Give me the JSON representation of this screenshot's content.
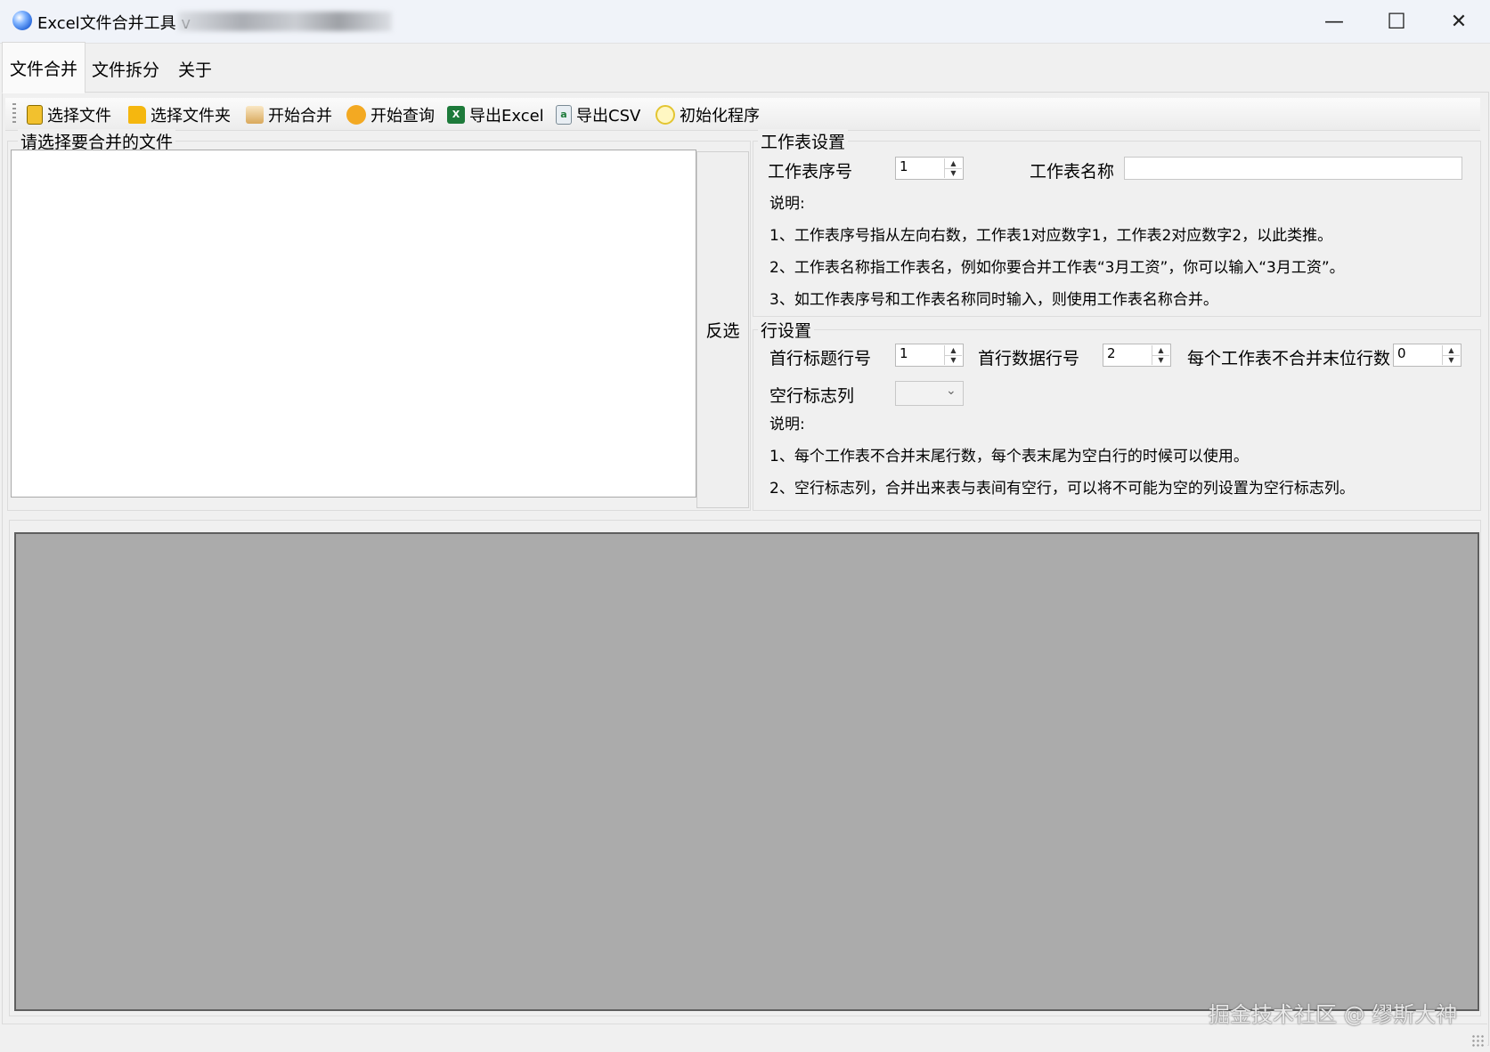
{
  "window": {
    "title": "Excel文件合并工具 v",
    "minimize": "—",
    "maximize": "☐",
    "close": "✕"
  },
  "tabs": [
    "文件合并",
    "文件拆分",
    "关于"
  ],
  "toolbar": {
    "items": [
      {
        "label": "选择文件",
        "icon": "file-icon"
      },
      {
        "label": "选择文件夹",
        "icon": "folder-icon"
      },
      {
        "label": "开始合并",
        "icon": "merge-icon"
      },
      {
        "label": "开始查询",
        "icon": "query-icon"
      },
      {
        "label": "导出Excel",
        "icon": "excel-icon"
      },
      {
        "label": "导出CSV",
        "icon": "csv-icon"
      },
      {
        "label": "初始化程序",
        "icon": "reset-icon"
      }
    ]
  },
  "file_group": {
    "title": "请选择要合并的文件",
    "invert_label": "反选"
  },
  "sheet_settings": {
    "title": "工作表设置",
    "index_label": "工作表序号",
    "index_value": "1",
    "name_label": "工作表名称",
    "name_value": "",
    "note_title": "说明:",
    "notes": [
      "1、工作表序号指从左向右数，工作表1对应数字1，工作表2对应数字2，以此类推。",
      "2、工作表名称指工作表名，例如你要合并工作表“3月工资”，你可以输入“3月工资”。",
      "3、如工作表序号和工作表名称同时输入，则使用工作表名称合并。"
    ]
  },
  "row_settings": {
    "title": "行设置",
    "header_row_label": "首行标题行号",
    "header_row_value": "1",
    "data_row_label": "首行数据行号",
    "data_row_value": "2",
    "skip_tail_label": "每个工作表不合并末位行数",
    "skip_tail_value": "0",
    "empty_flag_label": "空行标志列",
    "empty_flag_value": "",
    "note_title": "说明:",
    "notes": [
      "1、每个工作表不合并末尾行数，每个表末尾为空白行的时候可以使用。",
      "2、空行标志列，合并出来表与表间有空行，可以将不可能为空的列设置为空行标志列。"
    ]
  },
  "watermark": "掘金技术社区 @ 缪斯大神"
}
